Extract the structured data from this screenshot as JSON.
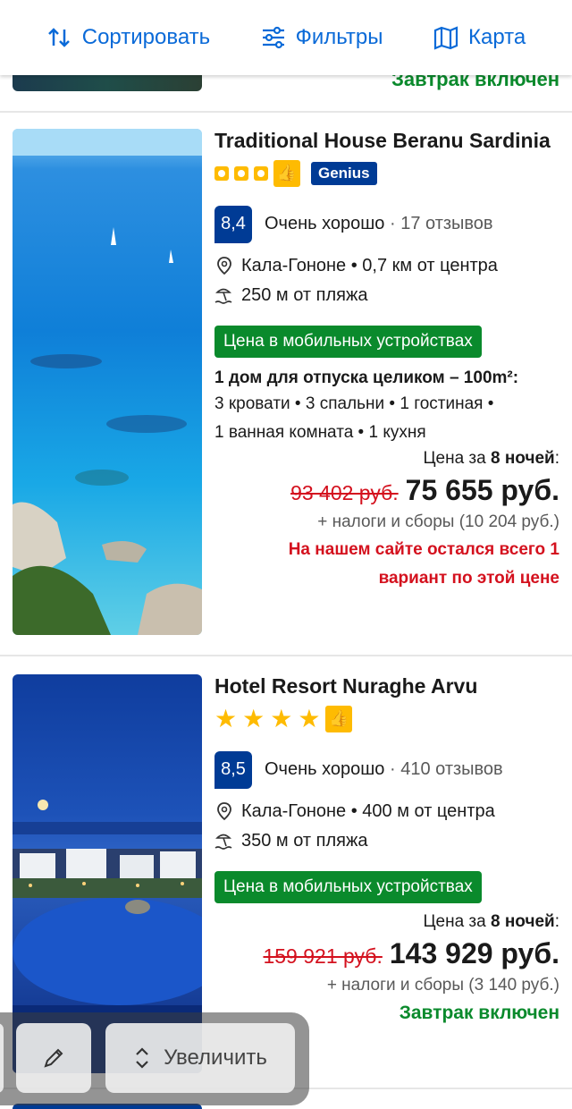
{
  "toolbar": {
    "sort": {
      "label": "Сортировать",
      "icon": "sort-icon"
    },
    "filters": {
      "label": "Фильтры",
      "icon": "sliders-icon"
    },
    "map": {
      "label": "Карта",
      "icon": "map-icon"
    },
    "accent_color": "#0a6ad8"
  },
  "previous_card": {
    "breakfast": "Завтрак включен"
  },
  "hotels": [
    {
      "name": "Traditional House Beranu Sardinia",
      "stars": 3,
      "star_style": "squares",
      "preferred": true,
      "genius": "Genius",
      "score": "8,4",
      "rating_word": "Очень хорошо",
      "reviews": "· 17 отзывов",
      "location": "Кала-Гононе • 0,7 км от центра",
      "beach": "250 м от пляжа",
      "mobile_badge": "Цена в мобильных устройствах",
      "unit_title": "1 дом для отпуска целиком – 100m²:",
      "unit_desc_1": "3 кровати • 3 спальни • 1 гостиная •",
      "unit_desc_2": "1 ванная комната • 1 кухня",
      "price_for_prefix": "Цена за",
      "price_for_nights": "8 ночей",
      "price_for_suffix": ":",
      "old_price": "93 402 руб.",
      "new_price": "75 655 руб.",
      "taxes": "+ налоги и сборы (10 204 руб.)",
      "scarcity_1": "На нашем сайте остался всего 1",
      "scarcity_2": "вариант по этой цене"
    },
    {
      "name": "Hotel Resort Nuraghe Arvu",
      "stars": 4,
      "star_style": "stars",
      "preferred": true,
      "score": "8,5",
      "rating_word": "Очень хорошо",
      "reviews": "· 410 отзывов",
      "location": "Кала-Гононе • 400 м от центра",
      "beach": "350 м от пляжа",
      "mobile_badge": "Цена в мобильных устройствах",
      "price_for_prefix": "Цена за",
      "price_for_nights": "8 ночей",
      "price_for_suffix": ":",
      "old_price": "159 921 руб.",
      "new_price": "143 929 руб.",
      "taxes": "+ налоги и сборы (3 140 руб.)",
      "breakfast": "Завтрак включен"
    }
  ],
  "overlay": {
    "zoom_label": "Увеличить",
    "pen_icon": "pencil-icon",
    "zoom_icon": "chevron-up-down-icon"
  },
  "colors": {
    "brand_blue": "#003b95",
    "green": "#0a8a2c",
    "red": "#d4111e",
    "yellow": "#febb02"
  }
}
